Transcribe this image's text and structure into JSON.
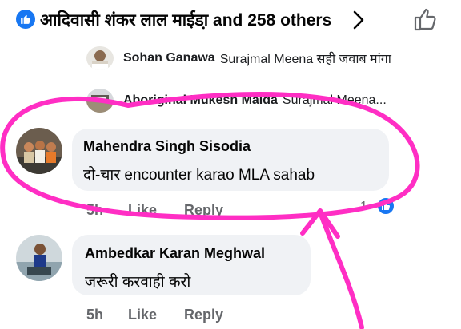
{
  "reactions": {
    "summary": "आदिवासी शंकर लाल माईडा़ and 258 others"
  },
  "replies_preview": [
    {
      "name": "Sohan Ganawa",
      "text": "Surajmal Meena सही जवाब मांगा"
    },
    {
      "name": "Aboriginal Mukesh Maida",
      "text": "Surajmal Meena..."
    }
  ],
  "comments": [
    {
      "name": "Mahendra Singh Sisodia",
      "text": "दो-चार encounter karao MLA sahab",
      "time": "5h",
      "like_label": "Like",
      "reply_label": "Reply",
      "reaction_count": "1"
    },
    {
      "name": "Ambedkar Karan Meghwal",
      "text": "जरूरी करवाही करो",
      "time": "5h",
      "like_label": "Like",
      "reply_label": "Reply"
    }
  ],
  "colors": {
    "brand_blue": "#1877f2",
    "bubble_gray": "#f0f2f5",
    "meta_gray": "#65676b",
    "annotation_pink": "#ff2ec4"
  },
  "icons": [
    "thumbs-up-icon",
    "chevron-right-icon",
    "like-outline-icon"
  ]
}
